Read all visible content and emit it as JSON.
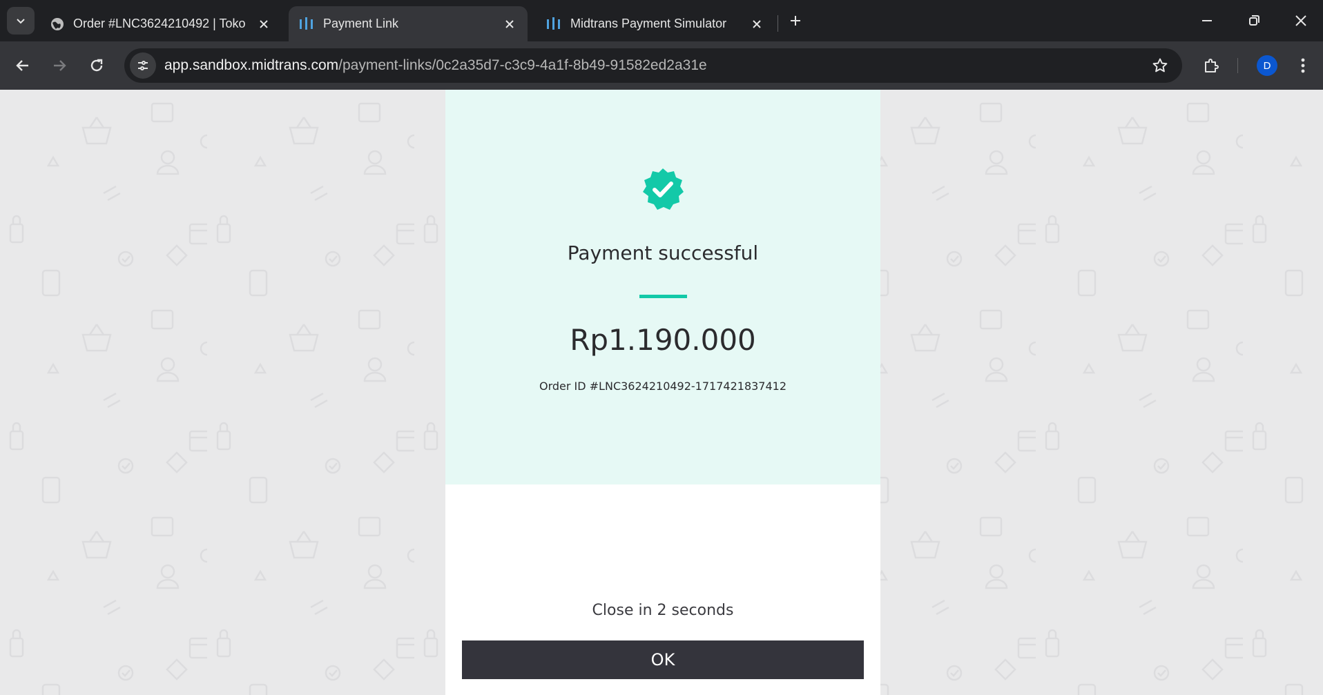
{
  "browser": {
    "tabs": [
      {
        "title": "Order #LNC3624210492 | Toko",
        "active": false,
        "icon": "globe-icon"
      },
      {
        "title": "Payment Link",
        "active": true,
        "icon": "midtrans-icon"
      },
      {
        "title": "Midtrans Payment Simulator",
        "active": false,
        "icon": "midtrans-icon"
      }
    ],
    "url_host": "app.sandbox.midtrans.com",
    "url_path": "/payment-links/0c2a35d7-c3c9-4a1f-8b49-91582ed2a31e",
    "profile_initial": "D"
  },
  "payment": {
    "status_title": "Payment successful",
    "amount": "Rp1.190.000",
    "order_id": "Order ID #LNC3624210492-1717421837412",
    "countdown": "Close in 2 seconds",
    "ok_label": "OK"
  },
  "colors": {
    "accent": "#13c9a8",
    "success_panel": "#e6f9f5",
    "button": "#34343c"
  }
}
